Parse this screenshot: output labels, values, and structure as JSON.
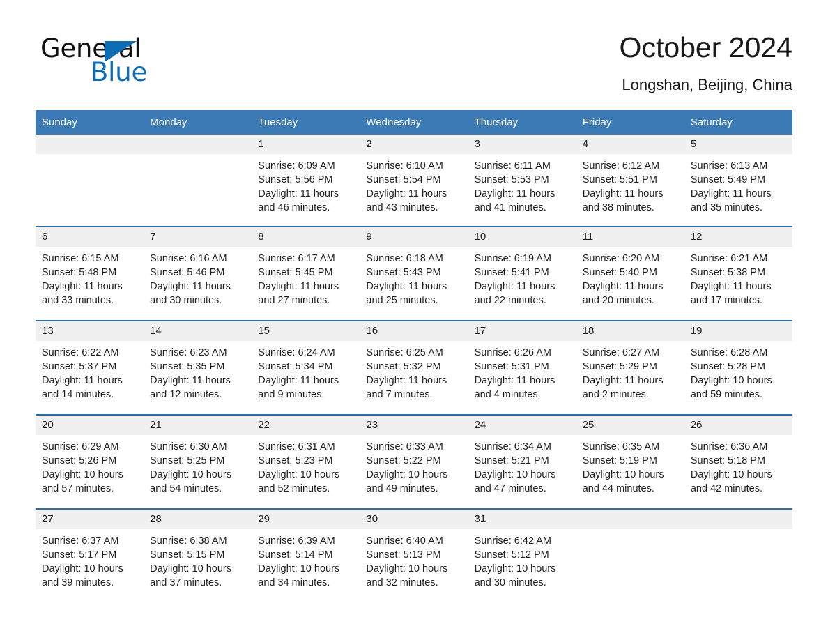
{
  "brand": {
    "name_first": "General",
    "name_second": "Blue",
    "accent_color": "#0d6cb4"
  },
  "header": {
    "title": "October 2024",
    "subtitle": "Longshan, Beijing, China"
  },
  "theme": {
    "header_blue": "#3b7ab5",
    "row_divider_blue": "#2e6da4",
    "daynum_band": "#f0f0f0",
    "text": "#1f1f1f"
  },
  "weekday_headers": [
    "Sunday",
    "Monday",
    "Tuesday",
    "Wednesday",
    "Thursday",
    "Friday",
    "Saturday"
  ],
  "weeks": [
    [
      {
        "day": "",
        "sunrise": "",
        "sunset": "",
        "daylight_line1": "",
        "daylight_line2": ""
      },
      {
        "day": "",
        "sunrise": "",
        "sunset": "",
        "daylight_line1": "",
        "daylight_line2": ""
      },
      {
        "day": "1",
        "sunrise": "Sunrise: 6:09 AM",
        "sunset": "Sunset: 5:56 PM",
        "daylight_line1": "Daylight: 11 hours",
        "daylight_line2": "and 46 minutes."
      },
      {
        "day": "2",
        "sunrise": "Sunrise: 6:10 AM",
        "sunset": "Sunset: 5:54 PM",
        "daylight_line1": "Daylight: 11 hours",
        "daylight_line2": "and 43 minutes."
      },
      {
        "day": "3",
        "sunrise": "Sunrise: 6:11 AM",
        "sunset": "Sunset: 5:53 PM",
        "daylight_line1": "Daylight: 11 hours",
        "daylight_line2": "and 41 minutes."
      },
      {
        "day": "4",
        "sunrise": "Sunrise: 6:12 AM",
        "sunset": "Sunset: 5:51 PM",
        "daylight_line1": "Daylight: 11 hours",
        "daylight_line2": "and 38 minutes."
      },
      {
        "day": "5",
        "sunrise": "Sunrise: 6:13 AM",
        "sunset": "Sunset: 5:49 PM",
        "daylight_line1": "Daylight: 11 hours",
        "daylight_line2": "and 35 minutes."
      }
    ],
    [
      {
        "day": "6",
        "sunrise": "Sunrise: 6:15 AM",
        "sunset": "Sunset: 5:48 PM",
        "daylight_line1": "Daylight: 11 hours",
        "daylight_line2": "and 33 minutes."
      },
      {
        "day": "7",
        "sunrise": "Sunrise: 6:16 AM",
        "sunset": "Sunset: 5:46 PM",
        "daylight_line1": "Daylight: 11 hours",
        "daylight_line2": "and 30 minutes."
      },
      {
        "day": "8",
        "sunrise": "Sunrise: 6:17 AM",
        "sunset": "Sunset: 5:45 PM",
        "daylight_line1": "Daylight: 11 hours",
        "daylight_line2": "and 27 minutes."
      },
      {
        "day": "9",
        "sunrise": "Sunrise: 6:18 AM",
        "sunset": "Sunset: 5:43 PM",
        "daylight_line1": "Daylight: 11 hours",
        "daylight_line2": "and 25 minutes."
      },
      {
        "day": "10",
        "sunrise": "Sunrise: 6:19 AM",
        "sunset": "Sunset: 5:41 PM",
        "daylight_line1": "Daylight: 11 hours",
        "daylight_line2": "and 22 minutes."
      },
      {
        "day": "11",
        "sunrise": "Sunrise: 6:20 AM",
        "sunset": "Sunset: 5:40 PM",
        "daylight_line1": "Daylight: 11 hours",
        "daylight_line2": "and 20 minutes."
      },
      {
        "day": "12",
        "sunrise": "Sunrise: 6:21 AM",
        "sunset": "Sunset: 5:38 PM",
        "daylight_line1": "Daylight: 11 hours",
        "daylight_line2": "and 17 minutes."
      }
    ],
    [
      {
        "day": "13",
        "sunrise": "Sunrise: 6:22 AM",
        "sunset": "Sunset: 5:37 PM",
        "daylight_line1": "Daylight: 11 hours",
        "daylight_line2": "and 14 minutes."
      },
      {
        "day": "14",
        "sunrise": "Sunrise: 6:23 AM",
        "sunset": "Sunset: 5:35 PM",
        "daylight_line1": "Daylight: 11 hours",
        "daylight_line2": "and 12 minutes."
      },
      {
        "day": "15",
        "sunrise": "Sunrise: 6:24 AM",
        "sunset": "Sunset: 5:34 PM",
        "daylight_line1": "Daylight: 11 hours",
        "daylight_line2": "and 9 minutes."
      },
      {
        "day": "16",
        "sunrise": "Sunrise: 6:25 AM",
        "sunset": "Sunset: 5:32 PM",
        "daylight_line1": "Daylight: 11 hours",
        "daylight_line2": "and 7 minutes."
      },
      {
        "day": "17",
        "sunrise": "Sunrise: 6:26 AM",
        "sunset": "Sunset: 5:31 PM",
        "daylight_line1": "Daylight: 11 hours",
        "daylight_line2": "and 4 minutes."
      },
      {
        "day": "18",
        "sunrise": "Sunrise: 6:27 AM",
        "sunset": "Sunset: 5:29 PM",
        "daylight_line1": "Daylight: 11 hours",
        "daylight_line2": "and 2 minutes."
      },
      {
        "day": "19",
        "sunrise": "Sunrise: 6:28 AM",
        "sunset": "Sunset: 5:28 PM",
        "daylight_line1": "Daylight: 10 hours",
        "daylight_line2": "and 59 minutes."
      }
    ],
    [
      {
        "day": "20",
        "sunrise": "Sunrise: 6:29 AM",
        "sunset": "Sunset: 5:26 PM",
        "daylight_line1": "Daylight: 10 hours",
        "daylight_line2": "and 57 minutes."
      },
      {
        "day": "21",
        "sunrise": "Sunrise: 6:30 AM",
        "sunset": "Sunset: 5:25 PM",
        "daylight_line1": "Daylight: 10 hours",
        "daylight_line2": "and 54 minutes."
      },
      {
        "day": "22",
        "sunrise": "Sunrise: 6:31 AM",
        "sunset": "Sunset: 5:23 PM",
        "daylight_line1": "Daylight: 10 hours",
        "daylight_line2": "and 52 minutes."
      },
      {
        "day": "23",
        "sunrise": "Sunrise: 6:33 AM",
        "sunset": "Sunset: 5:22 PM",
        "daylight_line1": "Daylight: 10 hours",
        "daylight_line2": "and 49 minutes."
      },
      {
        "day": "24",
        "sunrise": "Sunrise: 6:34 AM",
        "sunset": "Sunset: 5:21 PM",
        "daylight_line1": "Daylight: 10 hours",
        "daylight_line2": "and 47 minutes."
      },
      {
        "day": "25",
        "sunrise": "Sunrise: 6:35 AM",
        "sunset": "Sunset: 5:19 PM",
        "daylight_line1": "Daylight: 10 hours",
        "daylight_line2": "and 44 minutes."
      },
      {
        "day": "26",
        "sunrise": "Sunrise: 6:36 AM",
        "sunset": "Sunset: 5:18 PM",
        "daylight_line1": "Daylight: 10 hours",
        "daylight_line2": "and 42 minutes."
      }
    ],
    [
      {
        "day": "27",
        "sunrise": "Sunrise: 6:37 AM",
        "sunset": "Sunset: 5:17 PM",
        "daylight_line1": "Daylight: 10 hours",
        "daylight_line2": "and 39 minutes."
      },
      {
        "day": "28",
        "sunrise": "Sunrise: 6:38 AM",
        "sunset": "Sunset: 5:15 PM",
        "daylight_line1": "Daylight: 10 hours",
        "daylight_line2": "and 37 minutes."
      },
      {
        "day": "29",
        "sunrise": "Sunrise: 6:39 AM",
        "sunset": "Sunset: 5:14 PM",
        "daylight_line1": "Daylight: 10 hours",
        "daylight_line2": "and 34 minutes."
      },
      {
        "day": "30",
        "sunrise": "Sunrise: 6:40 AM",
        "sunset": "Sunset: 5:13 PM",
        "daylight_line1": "Daylight: 10 hours",
        "daylight_line2": "and 32 minutes."
      },
      {
        "day": "31",
        "sunrise": "Sunrise: 6:42 AM",
        "sunset": "Sunset: 5:12 PM",
        "daylight_line1": "Daylight: 10 hours",
        "daylight_line2": "and 30 minutes."
      },
      {
        "day": "",
        "sunrise": "",
        "sunset": "",
        "daylight_line1": "",
        "daylight_line2": ""
      },
      {
        "day": "",
        "sunrise": "",
        "sunset": "",
        "daylight_line1": "",
        "daylight_line2": ""
      }
    ]
  ]
}
